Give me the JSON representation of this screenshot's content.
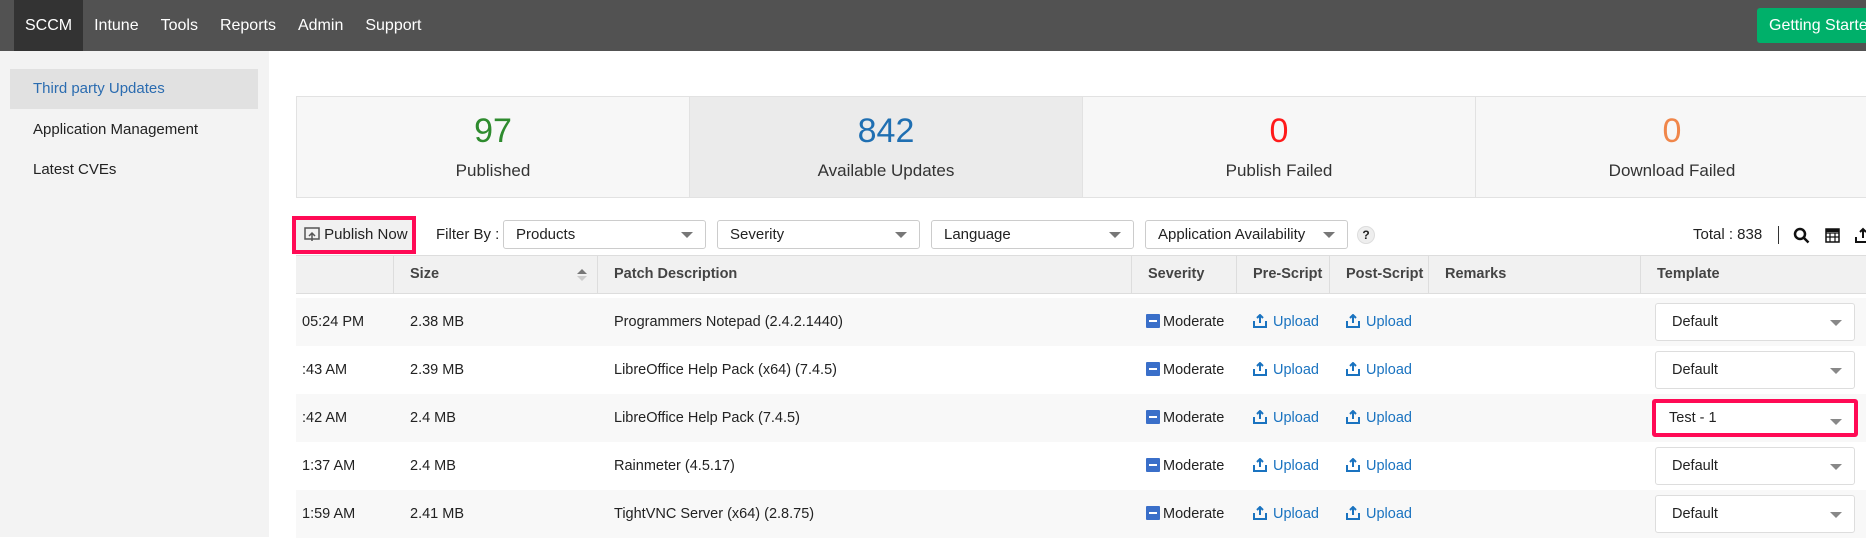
{
  "nav": {
    "items": [
      "SCCM",
      "Intune",
      "Tools",
      "Reports",
      "Admin",
      "Support"
    ],
    "active": "SCCM",
    "getting_started": "Getting Started"
  },
  "sidebar": {
    "items": [
      {
        "label": "Third party Updates",
        "active": true
      },
      {
        "label": "Application Management"
      },
      {
        "label": "Latest CVEs"
      }
    ]
  },
  "stats": [
    {
      "value": "97",
      "label": "Published",
      "color": "#2e8b2e"
    },
    {
      "value": "842",
      "label": "Available Updates",
      "color": "#1f6fb2"
    },
    {
      "value": "0",
      "label": "Publish Failed",
      "color": "#ff1a1a"
    },
    {
      "value": "0",
      "label": "Download Failed",
      "color": "#f0864a"
    }
  ],
  "toolbar": {
    "publish_now": "Publish Now",
    "filter_by": "Filter By :",
    "filters": [
      "Products",
      "Severity",
      "Language",
      "Application Availability"
    ],
    "help": "?",
    "total": "Total : 838"
  },
  "table": {
    "headers": [
      "",
      "Size",
      "Patch Description",
      "Severity",
      "Pre-Script",
      "Post-Script",
      "Remarks",
      "Template"
    ],
    "rows": [
      {
        "time": "05:24 PM",
        "size": "2.38 MB",
        "desc": "Programmers Notepad (2.4.2.1440)",
        "severity": "Moderate",
        "pre": "Upload",
        "post": "Upload",
        "remarks": "",
        "template": "Default"
      },
      {
        "time": ":43 AM",
        "size": "2.39 MB",
        "desc": "LibreOffice Help Pack (x64) (7.4.5)",
        "severity": "Moderate",
        "pre": "Upload",
        "post": "Upload",
        "remarks": "",
        "template": "Default"
      },
      {
        "time": ":42 AM",
        "size": "2.4 MB",
        "desc": "LibreOffice Help Pack (7.4.5)",
        "severity": "Moderate",
        "pre": "Upload",
        "post": "Upload",
        "remarks": "",
        "template": "Test - 1",
        "highlight": true
      },
      {
        "time": "1:37 AM",
        "size": "2.4 MB",
        "desc": "Rainmeter (4.5.17)",
        "severity": "Moderate",
        "pre": "Upload",
        "post": "Upload",
        "remarks": "",
        "template": "Default"
      },
      {
        "time": "1:59 AM",
        "size": "2.41 MB",
        "desc": "TightVNC Server (x64) (2.8.75)",
        "severity": "Moderate",
        "pre": "Upload",
        "post": "Upload",
        "remarks": "",
        "template": "Default"
      }
    ]
  }
}
